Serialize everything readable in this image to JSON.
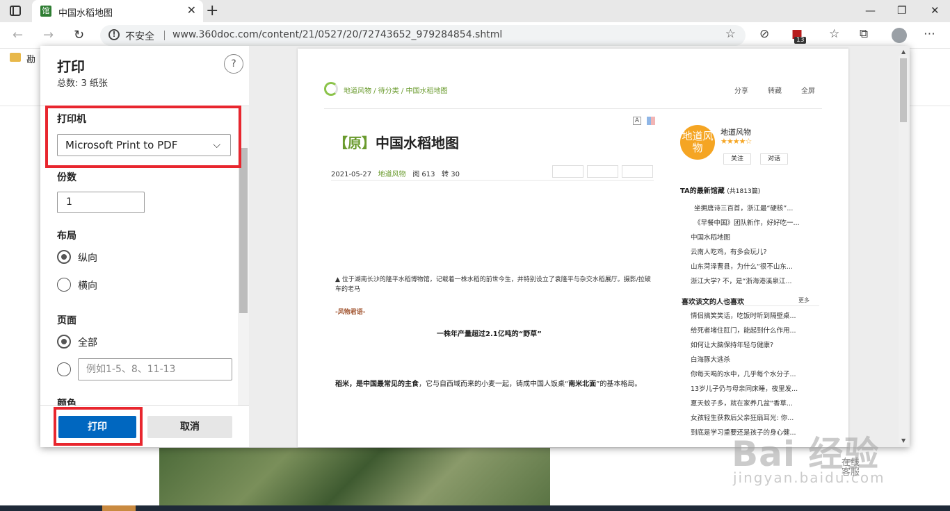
{
  "browser": {
    "tab_title": "中国水稻地图",
    "tab_favicon": "馆",
    "insecure_label": "不安全",
    "url": "www.360doc.com/content/21/0527/20/72743652_979284854.shtml",
    "extension_badge": "13",
    "bookmark_label": "勘"
  },
  "print_panel": {
    "title": "打印",
    "subtitle": "总数: 3 纸张",
    "help": "?",
    "printer_label": "打印机",
    "printer_value": "Microsoft Print to PDF",
    "copies_label": "份数",
    "copies_value": "1",
    "layout_label": "布局",
    "portrait": "纵向",
    "landscape": "横向",
    "pages_label": "页面",
    "pages_all": "全部",
    "pages_placeholder": "例如1-5、8、11-13",
    "color_label": "颜色",
    "print_button": "打印",
    "cancel_button": "取消"
  },
  "preview": {
    "breadcrumb": "地道风物 / 待分类 / 中国水稻地图",
    "share": "分享",
    "repost": "转藏",
    "fullscreen": "全屏",
    "font_btn": "A",
    "title_prefix": "【原】",
    "title": "中国水稻地图",
    "date": "2021-05-27",
    "author": "地道风物",
    "reads": "阅 613",
    "reposts": "转 30",
    "caption": "▲ 位于湖南长沙的隆平水稻博物馆，记载着一株水稻的前世今生，并特别设立了袁隆平与杂交水稻展厅。摄影/拉破车的老马",
    "fengwu": "-风物君语-",
    "subheading": "一株年产量超过2.1亿吨的“野草”",
    "para_bold1": "稻米，是中国最常见的主食",
    "para_mid": "，它与自西域而来的小麦一起，铸成中国人饭桌“",
    "para_bold2": "南米北面",
    "para_end": "”的基本格局。",
    "side": {
      "logo": "地道风物",
      "name": "地道风物",
      "stars": "★★★★☆",
      "follow": "关注",
      "chat": "对话",
      "latest_title": "TA的最新馆藏",
      "latest_count": "(共1813篇)",
      "latest": [
        "坐拥唐诗三百首，浙江最“硬核”...",
        "《早餐中国》团队新作，好好吃一...",
        "中国水稻地图",
        "云南人吃鸡，有多会玩儿?",
        "山东菏泽曹县，为什么“很不山东...",
        "浙江大学? 不，是“浙海港溪泉江..."
      ],
      "liked_title": "喜欢该文的人也喜欢",
      "more": "更多",
      "liked": [
        "情侣搞笑笑话，吃饭时听到隔壁桌...",
        "给死者堵住肛门，能起到什么作用...",
        "如何让大脑保持年轻与健康?",
        "白海豚大逃杀",
        "你每天喝的水中，几乎每个水分子...",
        "13岁儿子仍与母亲同床睡，夜里发...",
        "夏天蚊子多，就在家养几盆“香草...",
        "女孩轻生获救后父亲狂扇耳光: 你...",
        "到底是学习重要还是孩子的身心健..."
      ]
    }
  },
  "watermark": {
    "brand": "Bai 经验",
    "domain": "jingyan.baidu.com",
    "service": "在线客服"
  }
}
